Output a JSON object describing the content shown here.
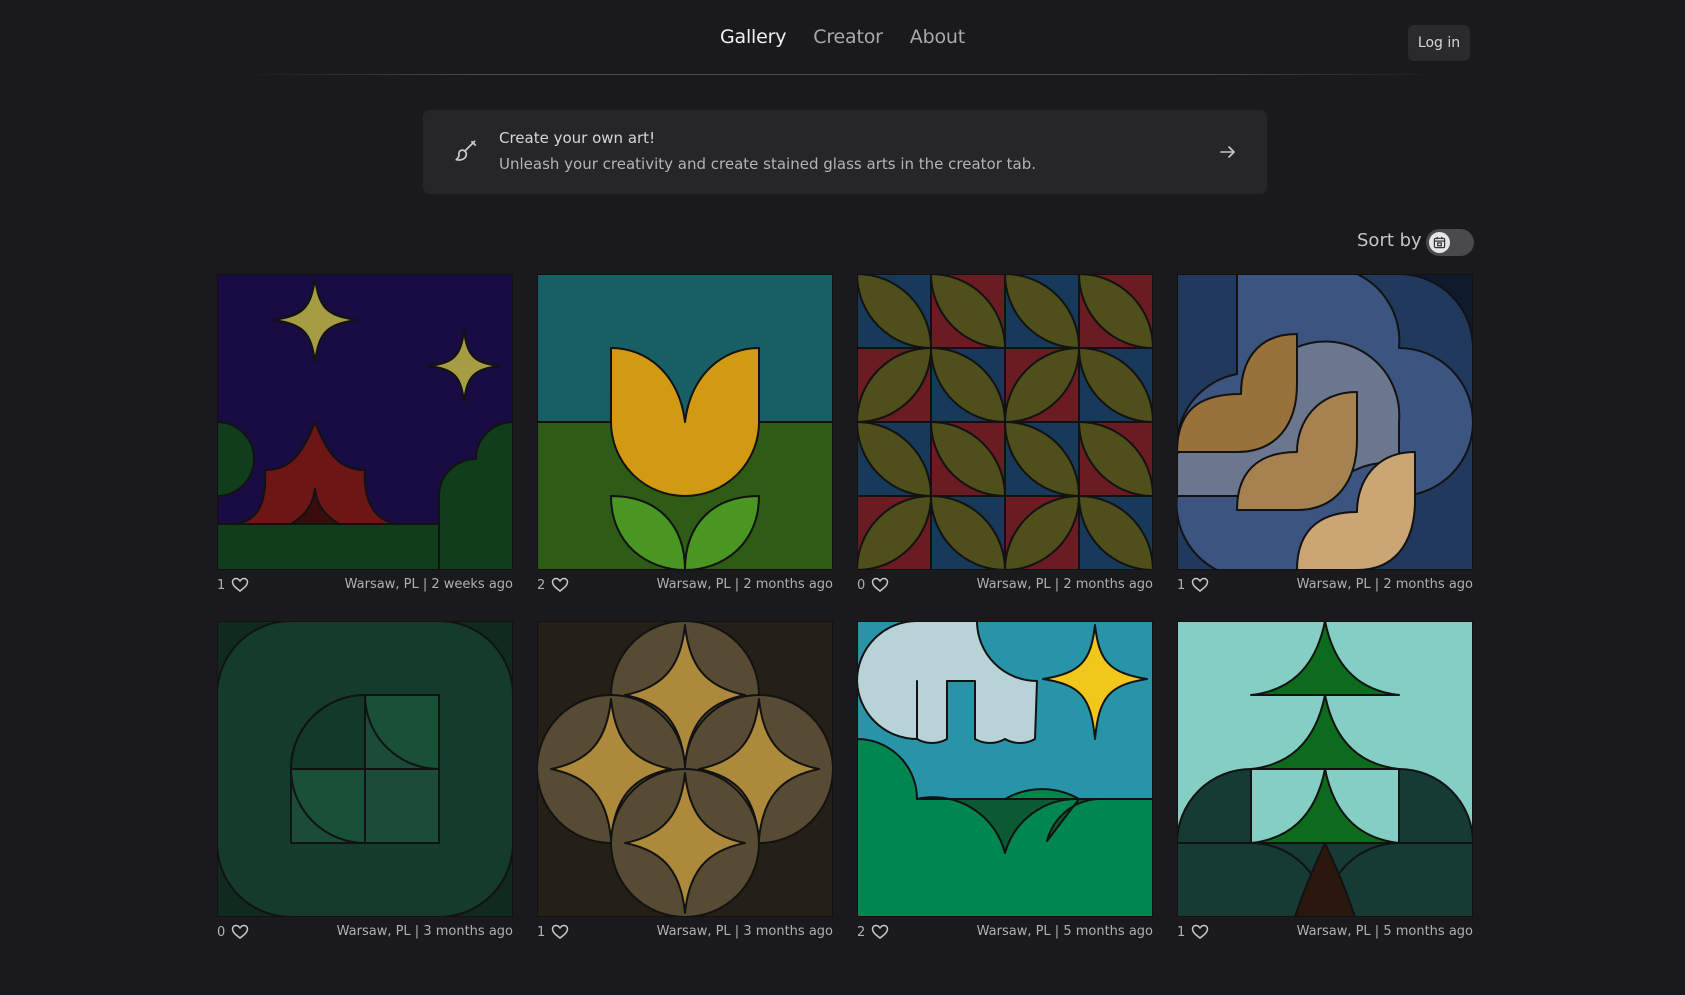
{
  "nav": {
    "items": [
      {
        "label": "Gallery",
        "active": true
      },
      {
        "label": "Creator",
        "active": false
      },
      {
        "label": "About",
        "active": false
      }
    ],
    "login_label": "Log in"
  },
  "banner": {
    "title": "Create your own art!",
    "subtitle": "Unleash your creativity and create stained glass arts in the creator tab.",
    "icon": "paintbrush-icon",
    "arrow_icon": "arrow-right-icon"
  },
  "sort": {
    "label": "Sort by",
    "toggle_icon": "calendar-icon",
    "toggle_on": false
  },
  "gallery": [
    {
      "likes": "1",
      "info": "Warsaw, PL | 2 weeks ago",
      "motif": "night-stars"
    },
    {
      "likes": "2",
      "info": "Warsaw, PL | 2 months ago",
      "motif": "tulip"
    },
    {
      "likes": "0",
      "info": "Warsaw, PL | 2 months ago",
      "motif": "petal-grid"
    },
    {
      "likes": "1",
      "info": "Warsaw, PL | 2 months ago",
      "motif": "blue-waves"
    },
    {
      "likes": "0",
      "info": "Warsaw, PL | 3 months ago",
      "motif": "green-squares"
    },
    {
      "likes": "1",
      "info": "Warsaw, PL | 3 months ago",
      "motif": "gold-diamonds"
    },
    {
      "likes": "2",
      "info": "Warsaw, PL | 5 months ago",
      "motif": "sky-star"
    },
    {
      "likes": "1",
      "info": "Warsaw, PL | 5 months ago",
      "motif": "pine-tree"
    }
  ],
  "colors": {
    "background": "#1a1a1c",
    "banner_bg": "#262628",
    "text_primary": "#f1f1f3",
    "text_muted": "#a8a8ad"
  }
}
